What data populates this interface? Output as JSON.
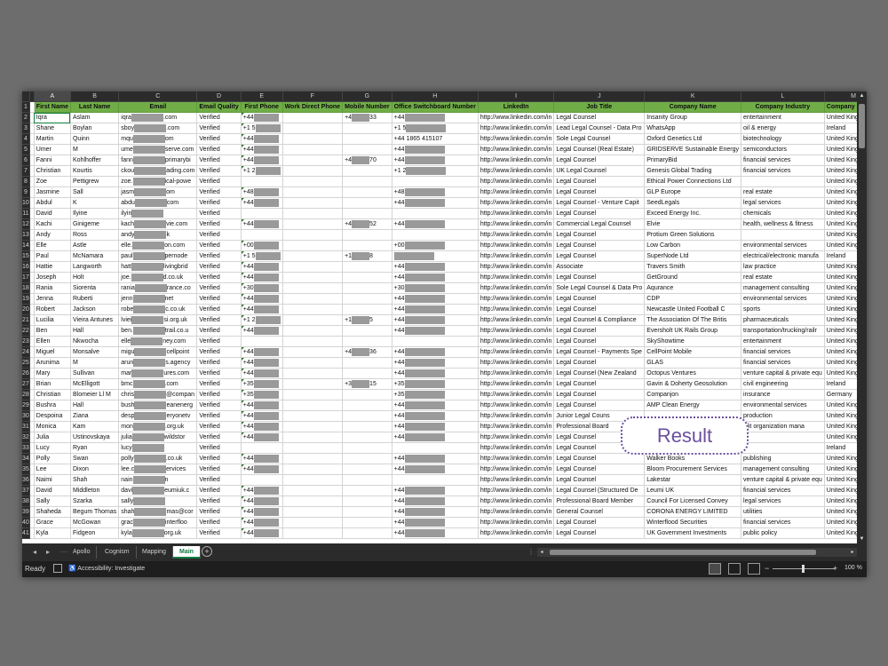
{
  "columns": [
    "A",
    "B",
    "C",
    "D",
    "E",
    "F",
    "G",
    "H",
    "I",
    "J",
    "K",
    "L",
    "M"
  ],
  "headers": [
    "First Name",
    "Last Name",
    "Email",
    "Email Quality",
    "First Phone",
    "Work Direct Phone",
    "Mobile Number",
    "Office Switchboard Number",
    "LinkedIn",
    "Job Title",
    "Company Name",
    "Company Industry",
    "Company Country"
  ],
  "rows": [
    {
      "n": "2",
      "a": "Iqra",
      "b": "Aslam",
      "c1": "iqra",
      "c2": ".com",
      "d": "Verified",
      "e": "+44",
      "g1": "+4",
      "g2": "33",
      "h": "+44",
      "i": "http://www.linkedin.com/in",
      "j": "Legal Counsel",
      "k": "Insanity Group",
      "l": "entertainment",
      "m": "United Kingdom"
    },
    {
      "n": "3",
      "a": "Shane",
      "b": "Boylan",
      "c1": "sboy",
      "c2": ".com",
      "d": "Verified",
      "e": "+1 5",
      "g1": "",
      "g2": "",
      "h": "+1 5",
      "i": "http://www.linkedin.com/in",
      "j": "Lead Legal Counsel - Data Pro",
      "k": "WhatsApp",
      "l": "oil & energy",
      "m": "Ireland"
    },
    {
      "n": "4",
      "a": "Martin",
      "b": "Quinn",
      "c1": "mqu",
      "c2": "om",
      "d": "Verified",
      "e": "+44",
      "g1": "",
      "g2": "",
      "h": "+44 1865 415107",
      "i": "http://www.linkedin.com/in",
      "j": "Sole Legal Counsel",
      "k": "Oxford Genetics Ltd",
      "l": "biotechnology",
      "m": "United Kingdom"
    },
    {
      "n": "5",
      "a": "Umer",
      "b": "M",
      "c1": "ume",
      "c2": "serve.com",
      "d": "Verified",
      "e": "+44",
      "g1": "",
      "g2": "",
      "h": "+44",
      "i": "http://www.linkedin.com/in",
      "j": "Legal Counsel (Real Estate)",
      "k": "GRIDSERVE Sustainable Energy",
      "l": "semiconductors",
      "m": "United Kingdom"
    },
    {
      "n": "6",
      "a": "Fanni",
      "b": "Kohlhoffer",
      "c1": "fann",
      "c2": "primarybi",
      "d": "Verified",
      "e": "+44",
      "g1": "+4",
      "g2": "70",
      "h": "+44",
      "i": "http://www.linkedin.com/in",
      "j": "Legal Counsel",
      "k": "PrimaryBid",
      "l": "financial services",
      "m": "United Kingdom"
    },
    {
      "n": "7",
      "a": "Christian",
      "b": "Kourtis",
      "c1": "ckou",
      "c2": "ading.com",
      "d": "Verified",
      "e": "+1 2",
      "g1": "",
      "g2": "",
      "h": "+1 2",
      "i": "http://www.linkedin.com/in",
      "j": "UK Legal Counsel",
      "k": "Genesis Global Trading",
      "l": "financial services",
      "m": "United Kingdom"
    },
    {
      "n": "8",
      "a": "Zoe",
      "b": "Pettigrew",
      "c1": "zoe.",
      "c2": "ical-powe",
      "d": "Verified",
      "e": "",
      "g1": "",
      "g2": "",
      "h": "",
      "i": "http://www.linkedin.com/in",
      "j": "Legal Counsel",
      "k": "Ethical Power Connections Ltd",
      "l": "",
      "m": "United Kingdom"
    },
    {
      "n": "9",
      "a": "Jasmine",
      "b": "Sall",
      "c1": "jasm",
      "c2": "om",
      "d": "Verified",
      "e": "+48",
      "g1": "",
      "g2": "",
      "h": "+48",
      "i": "http://www.linkedin.com/in",
      "j": "Legal Counsel",
      "k": "GLP Europe",
      "l": "real estate",
      "m": "United Kingdom"
    },
    {
      "n": "10",
      "a": "Abdul",
      "b": "K",
      "c1": "abdu",
      "c2": "com",
      "d": "Verified",
      "e": "+44",
      "g1": "",
      "g2": "",
      "h": "+44",
      "i": "http://www.linkedin.com/in",
      "j": "Legal Counsel - Venture Capit",
      "k": "SeedLegals",
      "l": "legal services",
      "m": "United Kingdom"
    },
    {
      "n": "11",
      "a": "David",
      "b": "Ilyine",
      "c1": "ilyin",
      "c2": "",
      "d": "Verified",
      "e": "",
      "g1": "",
      "g2": "",
      "h": "",
      "i": "http://www.linkedin.com/in",
      "j": "Legal Counsel",
      "k": "Exceed Energy Inc.",
      "l": "chemicals",
      "m": "United Kingdom"
    },
    {
      "n": "12",
      "a": "Kachi",
      "b": "Ginigeme",
      "c1": "kach",
      "c2": "vie.com",
      "d": "Verified",
      "e": "+44",
      "g1": "+4",
      "g2": "52",
      "h": "+44",
      "i": "http://www.linkedin.com/in",
      "j": "Commercial Legal Counsel",
      "k": "Elvie",
      "l": "health, wellness & fitness",
      "m": "United Kingdom"
    },
    {
      "n": "13",
      "a": "Andy",
      "b": "Ross",
      "c1": "andy",
      "c2": "k",
      "d": "Verified",
      "e": "",
      "g1": "",
      "g2": "",
      "h": "",
      "i": "http://www.linkedin.com/in",
      "j": "Legal Counsel",
      "k": "Protium Green Solutions",
      "l": "",
      "m": "United Kingdom"
    },
    {
      "n": "14",
      "a": "Elle",
      "b": "Astle",
      "c1": "elle.",
      "c2": "on.com",
      "d": "Verified",
      "e": "+00",
      "g1": "",
      "g2": "",
      "h": "+00",
      "i": "http://www.linkedin.com/in",
      "j": "Legal Counsel",
      "k": "Low Carbon",
      "l": "environmental services",
      "m": "United Kingdom"
    },
    {
      "n": "15",
      "a": "Paul",
      "b": "McNamara",
      "c1": "paul",
      "c2": "pernode",
      "d": "Verified",
      "e": "+1 5",
      "g1": "+1",
      "g2": "8",
      "h": "",
      "i": "http://www.linkedin.com/in",
      "j": "Legal Counsel",
      "k": "SuperNode Ltd",
      "l": "electrical/electronic manufa",
      "m": "Ireland"
    },
    {
      "n": "16",
      "a": "Hattie",
      "b": "Langworth",
      "c1": "hatt",
      "c2": "livingbrid",
      "d": "Verified",
      "e": "+44",
      "g1": "",
      "g2": "",
      "h": "+44",
      "i": "http://www.linkedin.com/in",
      "j": "Associate",
      "k": "Travers Smith",
      "l": "law practice",
      "m": "United Kingdom"
    },
    {
      "n": "17",
      "a": "Joseph",
      "b": "Holt",
      "c1": "joe.",
      "c2": "d.co.uk",
      "d": "Verified",
      "e": "+44",
      "g1": "",
      "g2": "",
      "h": "+44",
      "i": "http://www.linkedin.com/in",
      "j": "Legal Counsel",
      "k": "GetGround",
      "l": "real estate",
      "m": "United Kingdom"
    },
    {
      "n": "18",
      "a": "Rania",
      "b": "Siorenta",
      "c1": "rania",
      "c2": "rance.co",
      "d": "Verified",
      "e": "+30",
      "g1": "",
      "g2": "",
      "h": "+30",
      "i": "http://www.linkedin.com/in",
      "j": "Sole Legal Counsel & Data Pro",
      "k": "Aqurance",
      "l": "management consulting",
      "m": "United Kingdom"
    },
    {
      "n": "19",
      "a": "Jenna",
      "b": "Ruberti",
      "c1": "jenn",
      "c2": "net",
      "d": "Verified",
      "e": "+44",
      "g1": "",
      "g2": "",
      "h": "+44",
      "i": "http://www.linkedin.com/in",
      "j": "Legal Counsel",
      "k": "CDP",
      "l": "environmental services",
      "m": "United Kingdom"
    },
    {
      "n": "20",
      "a": "Robert",
      "b": "Jackson",
      "c1": "robe",
      "c2": "c.co.uk",
      "d": "Verified",
      "e": "+44",
      "g1": "",
      "g2": "",
      "h": "+44",
      "i": "http://www.linkedin.com/in",
      "j": "Legal Counsel",
      "k": "Newcastle United Football C",
      "l": "sports",
      "m": "United Kingdom"
    },
    {
      "n": "21",
      "a": "Lucilia",
      "b": "Vieira Antunes",
      "c1": "lviei",
      "c2": "si.org.uk",
      "d": "Verified",
      "e": "+1 2",
      "g1": "+1",
      "g2": "5",
      "h": "+44",
      "i": "http://www.linkedin.com/in",
      "j": "Legal Counsel & Compliance",
      "k": "The Association Of The Britis",
      "l": "pharmaceuticals",
      "m": "United Kingdom"
    },
    {
      "n": "22",
      "a": "Ben",
      "b": "Hall",
      "c1": "ben.",
      "c2": "trail.co.u",
      "d": "Verified",
      "e": "+44",
      "g1": "",
      "g2": "",
      "h": "+44",
      "i": "http://www.linkedin.com/in",
      "j": "Legal Counsel",
      "k": "Eversholt UK Rails Group",
      "l": "transportation/trucking/railr",
      "m": "United Kingdom"
    },
    {
      "n": "23",
      "a": "Ellen",
      "b": "Nkwocha",
      "c1": "elle",
      "c2": "ney.com",
      "d": "Verified",
      "e": "",
      "g1": "",
      "g2": "",
      "h": "",
      "i": "http://www.linkedin.com/in",
      "j": "Legal Counsel",
      "k": "SkyShowtime",
      "l": "entertainment",
      "m": "United Kingdom"
    },
    {
      "n": "24",
      "a": "Miguel",
      "b": "Monsalve",
      "c1": "migu",
      "c2": "cellpoint",
      "d": "Verified",
      "e": "+44",
      "g1": "+4",
      "g2": "36",
      "h": "+44",
      "i": "http://www.linkedin.com/in",
      "j": "Legal Counsel - Payments Spe",
      "k": "CellPoint Mobile",
      "l": "financial services",
      "m": "United Kingdom"
    },
    {
      "n": "25",
      "a": "Arunima",
      "b": "M",
      "c1": "arun",
      "c2": "s.agency",
      "d": "Verified",
      "e": "+44",
      "g1": "",
      "g2": "",
      "h": "+44",
      "i": "http://www.linkedin.com/in",
      "j": "Legal Counsel",
      "k": "GLAS",
      "l": "financial services",
      "m": "United Kingdom"
    },
    {
      "n": "26",
      "a": "Mary",
      "b": "Sullivan",
      "c1": "mar",
      "c2": "ures.com",
      "d": "Verified",
      "e": "+44",
      "g1": "",
      "g2": "",
      "h": "+44",
      "i": "http://www.linkedin.com/in",
      "j": "Legal Counsel (New Zealand",
      "k": "Octopus Ventures",
      "l": "venture capital & private equ",
      "m": "United Kingdom"
    },
    {
      "n": "27",
      "a": "Brian",
      "b": "McElligott",
      "c1": "bmc",
      "c2": ".com",
      "d": "Verified",
      "e": "+35",
      "g1": "+3",
      "g2": "15",
      "h": "+35",
      "i": "http://www.linkedin.com/in",
      "j": "Legal Counsel",
      "k": "Gavin & Doherty Geosolution",
      "l": "civil engineering",
      "m": "Ireland"
    },
    {
      "n": "28",
      "a": "Christian",
      "b": "Blomeier Ll M",
      "c1": "chris",
      "c2": "@compan",
      "d": "Verified",
      "e": "+35",
      "g1": "",
      "g2": "",
      "h": "+35",
      "i": "http://www.linkedin.com/in",
      "j": "Legal Counsel",
      "k": "Companjon",
      "l": "insurance",
      "m": "Germany"
    },
    {
      "n": "29",
      "a": "Bushra",
      "b": "Hall",
      "c1": "bush",
      "c2": "eanenerg",
      "d": "Verified",
      "e": "+44",
      "g1": "",
      "g2": "",
      "h": "+44",
      "i": "http://www.linkedin.com/in",
      "j": "Legal Counsel",
      "k": "AMP Clean Energy",
      "l": "environmental services",
      "m": "United Kingdom"
    },
    {
      "n": "30",
      "a": "Despoina",
      "b": "Ziana",
      "c1": "desp",
      "c2": "eryonetv",
      "d": "Verified",
      "e": "+44",
      "g1": "",
      "g2": "",
      "h": "+44",
      "i": "http://www.linkedin.com/in",
      "j": "Junior Legal Couns",
      "k": "",
      "l": "production",
      "m": "United Kingdom"
    },
    {
      "n": "31",
      "a": "Monica",
      "b": "Kam",
      "c1": "mon",
      "c2": ".org.uk",
      "d": "Verified",
      "e": "+44",
      "g1": "",
      "g2": "",
      "h": "+44",
      "i": "http://www.linkedin.com/in",
      "j": "Professional Board",
      "k": "",
      "l": "ofit organization mana",
      "m": "United Kingdom"
    },
    {
      "n": "32",
      "a": "Julia",
      "b": "Ustinovskaya",
      "c1": "julia",
      "c2": "wildstor",
      "d": "Verified",
      "e": "+44",
      "g1": "",
      "g2": "",
      "h": "+44",
      "i": "http://www.linkedin.com/in",
      "j": "Legal Counsel",
      "k": "",
      "l": "",
      "m": "United Kingdom"
    },
    {
      "n": "33",
      "a": "Lucy",
      "b": "Ryan",
      "c1": "lucy",
      "c2": "",
      "d": "Verified",
      "e": "",
      "g1": "",
      "g2": "",
      "h": "",
      "i": "http://www.linkedin.com/in",
      "j": "Legal Counsel",
      "k": "",
      "l": "",
      "m": "Ireland"
    },
    {
      "n": "34",
      "a": "Polly",
      "b": "Swan",
      "c1": "polly",
      "c2": ".co.uk",
      "d": "Verified",
      "e": "+44",
      "g1": "",
      "g2": "",
      "h": "+44",
      "i": "http://www.linkedin.com/in",
      "j": "Legal Counsel",
      "k": "Walker Books",
      "l": "publishing",
      "m": "United Kingdom"
    },
    {
      "n": "35",
      "a": "Lee",
      "b": "Dixon",
      "c1": "lee.c",
      "c2": "ervices",
      "d": "Verified",
      "e": "+44",
      "g1": "",
      "g2": "",
      "h": "+44",
      "i": "http://www.linkedin.com/in",
      "j": "Legal Counsel",
      "k": "Bloom Procurement Services",
      "l": "management consulting",
      "m": "United Kingdom"
    },
    {
      "n": "36",
      "a": "Naimi",
      "b": "Shah",
      "c1": "nain",
      "c2": "n",
      "d": "Verified",
      "e": "",
      "g1": "",
      "g2": "",
      "h": "",
      "i": "http://www.linkedin.com/in",
      "j": "Legal Counsel",
      "k": "Lakestar",
      "l": "venture capital & private equ",
      "m": "United Kingdom"
    },
    {
      "n": "37",
      "a": "David",
      "b": "Middleton",
      "c1": "davi",
      "c2": "eumiuk.c",
      "d": "Verified",
      "e": "+44",
      "g1": "",
      "g2": "",
      "h": "+44",
      "i": "http://www.linkedin.com/in",
      "j": "Legal Counsel (Structured De",
      "k": "Leumi UK",
      "l": "financial services",
      "m": "United Kingdom"
    },
    {
      "n": "38",
      "a": "Sally",
      "b": "Szarka",
      "c1": "sally",
      "c2": "",
      "d": "Verified",
      "e": "+44",
      "g1": "",
      "g2": "",
      "h": "+44",
      "i": "http://www.linkedin.com/in",
      "j": "Professional Board Member",
      "k": "Council For Licensed Convey",
      "l": "legal services",
      "m": "United Kingdom"
    },
    {
      "n": "39",
      "a": "Shaheda",
      "b": "Begum Thomas",
      "c1": "shah",
      "c2": "mas@cor",
      "d": "Verified",
      "e": "+44",
      "g1": "",
      "g2": "",
      "h": "+44",
      "i": "http://www.linkedin.com/in",
      "j": "General Counsel",
      "k": "CORONA ENERGY LIMITED",
      "l": "utilities",
      "m": "United Kingdom"
    },
    {
      "n": "40",
      "a": "Grace",
      "b": "McGowan",
      "c1": "grac",
      "c2": "interfloo",
      "d": "Verified",
      "e": "+44",
      "g1": "",
      "g2": "",
      "h": "+44",
      "i": "http://www.linkedin.com/in",
      "j": "Legal Counsel",
      "k": "Winterflood Securities",
      "l": "financial services",
      "m": "United Kingdom"
    },
    {
      "n": "41",
      "a": "Kyla",
      "b": "Fidgeon",
      "c1": "kyla",
      "c2": "org.uk",
      "d": "Verified",
      "e": "+44",
      "g1": "",
      "g2": "",
      "h": "+44",
      "i": "http://www.linkedin.com/in",
      "j": "Legal Counsel",
      "k": "UK Government Investments",
      "l": "public policy",
      "m": "United Kingdom"
    }
  ],
  "sheet_tabs": [
    "Apollo",
    "Cognism",
    "Mapping",
    "Main"
  ],
  "active_tab": "Main",
  "status": {
    "ready": "Ready",
    "accessibility": "Accessibility: Investigate",
    "zoom": "100 %"
  },
  "overlay_label": "Result",
  "colors": {
    "header_green": "#70ad47",
    "excel_green": "#107c41",
    "overlay_purple": "#6b4f9e"
  }
}
